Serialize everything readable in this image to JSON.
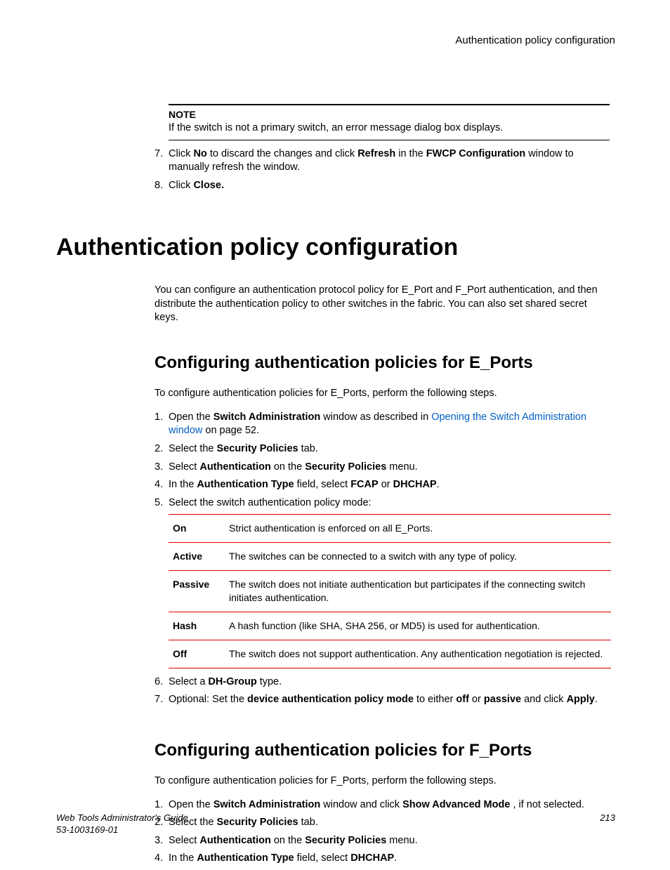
{
  "running_head": "Authentication policy configuration",
  "note": {
    "label": "NOTE",
    "text": "If the switch is not a primary switch, an error message dialog box displays."
  },
  "top_list": {
    "item7": {
      "num": "7.",
      "pre": "Click ",
      "b1": "No",
      "mid1": " to discard the changes and click ",
      "b2": "Refresh",
      "mid2": " in the ",
      "b3": "FWCP Configuration",
      "post": " window to manually refresh the window."
    },
    "item8": {
      "num": "8.",
      "pre": "Click ",
      "b1": "Close."
    }
  },
  "h1": "Authentication policy configuration",
  "intro": "You can configure an authentication protocol policy for E_Port and F_Port authentication, and then distribute the authentication policy to other switches in the fabric. You can also set shared secret keys.",
  "sectionE": {
    "title": "Configuring authentication policies for E_Ports",
    "intro": "To configure authentication policies for E_Ports, perform the following steps.",
    "steps": {
      "s1": {
        "num": "1.",
        "t1": "Open the ",
        "b1": "Switch Administration",
        "t2": " window as described in ",
        "link": "Opening the Switch Administration window",
        "t3": " on page 52."
      },
      "s2": {
        "num": "2.",
        "t1": "Select the ",
        "b1": "Security Policies",
        "t2": " tab."
      },
      "s3": {
        "num": "3.",
        "t1": "Select ",
        "b1": "Authentication",
        "t2": " on the ",
        "b2": "Security Policies",
        "t3": " menu."
      },
      "s4": {
        "num": "4.",
        "t1": "In the ",
        "b1": "Authentication Type",
        "t2": " field, select ",
        "b2": "FCAP",
        "t3": " or ",
        "b3": "DHCHAP",
        "t4": "."
      },
      "s5": {
        "num": "5.",
        "t1": "Select the switch authentication policy mode:"
      },
      "s6": {
        "num": "6.",
        "t1": "Select a ",
        "b1": "DH-Group",
        "t2": " type."
      },
      "s7": {
        "num": "7.",
        "t1": "Optional: Set the ",
        "b1": "device authentication policy mode",
        "t2": " to either ",
        "b2": "off",
        "t3": " or ",
        "b3": "passive",
        "t4": " and click ",
        "b4": "Apply",
        "t5": "."
      }
    },
    "table": [
      {
        "k": "On",
        "v": "Strict authentication is enforced on all E_Ports."
      },
      {
        "k": "Active",
        "v": "The switches can be connected to a switch with any type of policy."
      },
      {
        "k": "Passive",
        "v": "The switch does not initiate authentication but participates if the connecting switch initiates authentication."
      },
      {
        "k": "Hash",
        "v": "A hash function (like SHA, SHA 256, or MD5) is used for authentication."
      },
      {
        "k": "Off",
        "v": "The switch does not support authentication. Any authentication negotiation is rejected."
      }
    ]
  },
  "sectionF": {
    "title": "Configuring authentication policies for F_Ports",
    "intro": "To configure authentication policies for F_Ports, perform the following steps.",
    "steps": {
      "s1": {
        "num": "1.",
        "t1": "Open the ",
        "b1": "Switch Administration",
        "t2": " window and click ",
        "b2": "Show Advanced Mode ",
        "t3": ", if not selected."
      },
      "s2": {
        "num": "2.",
        "t1": "Select the ",
        "b1": "Security Policies",
        "t2": " tab."
      },
      "s3": {
        "num": "3.",
        "t1": "Select ",
        "b1": "Authentication",
        "t2": " on the ",
        "b2": "Security Policies",
        "t3": " menu."
      },
      "s4": {
        "num": "4.",
        "t1": "In the ",
        "b1": "Authentication Type",
        "t2": " field, select ",
        "b2": "DHCHAP",
        "t3": "."
      }
    }
  },
  "footer": {
    "title": "Web Tools Administrator's Guide",
    "docnum": "53-1003169-01",
    "page": "213"
  }
}
